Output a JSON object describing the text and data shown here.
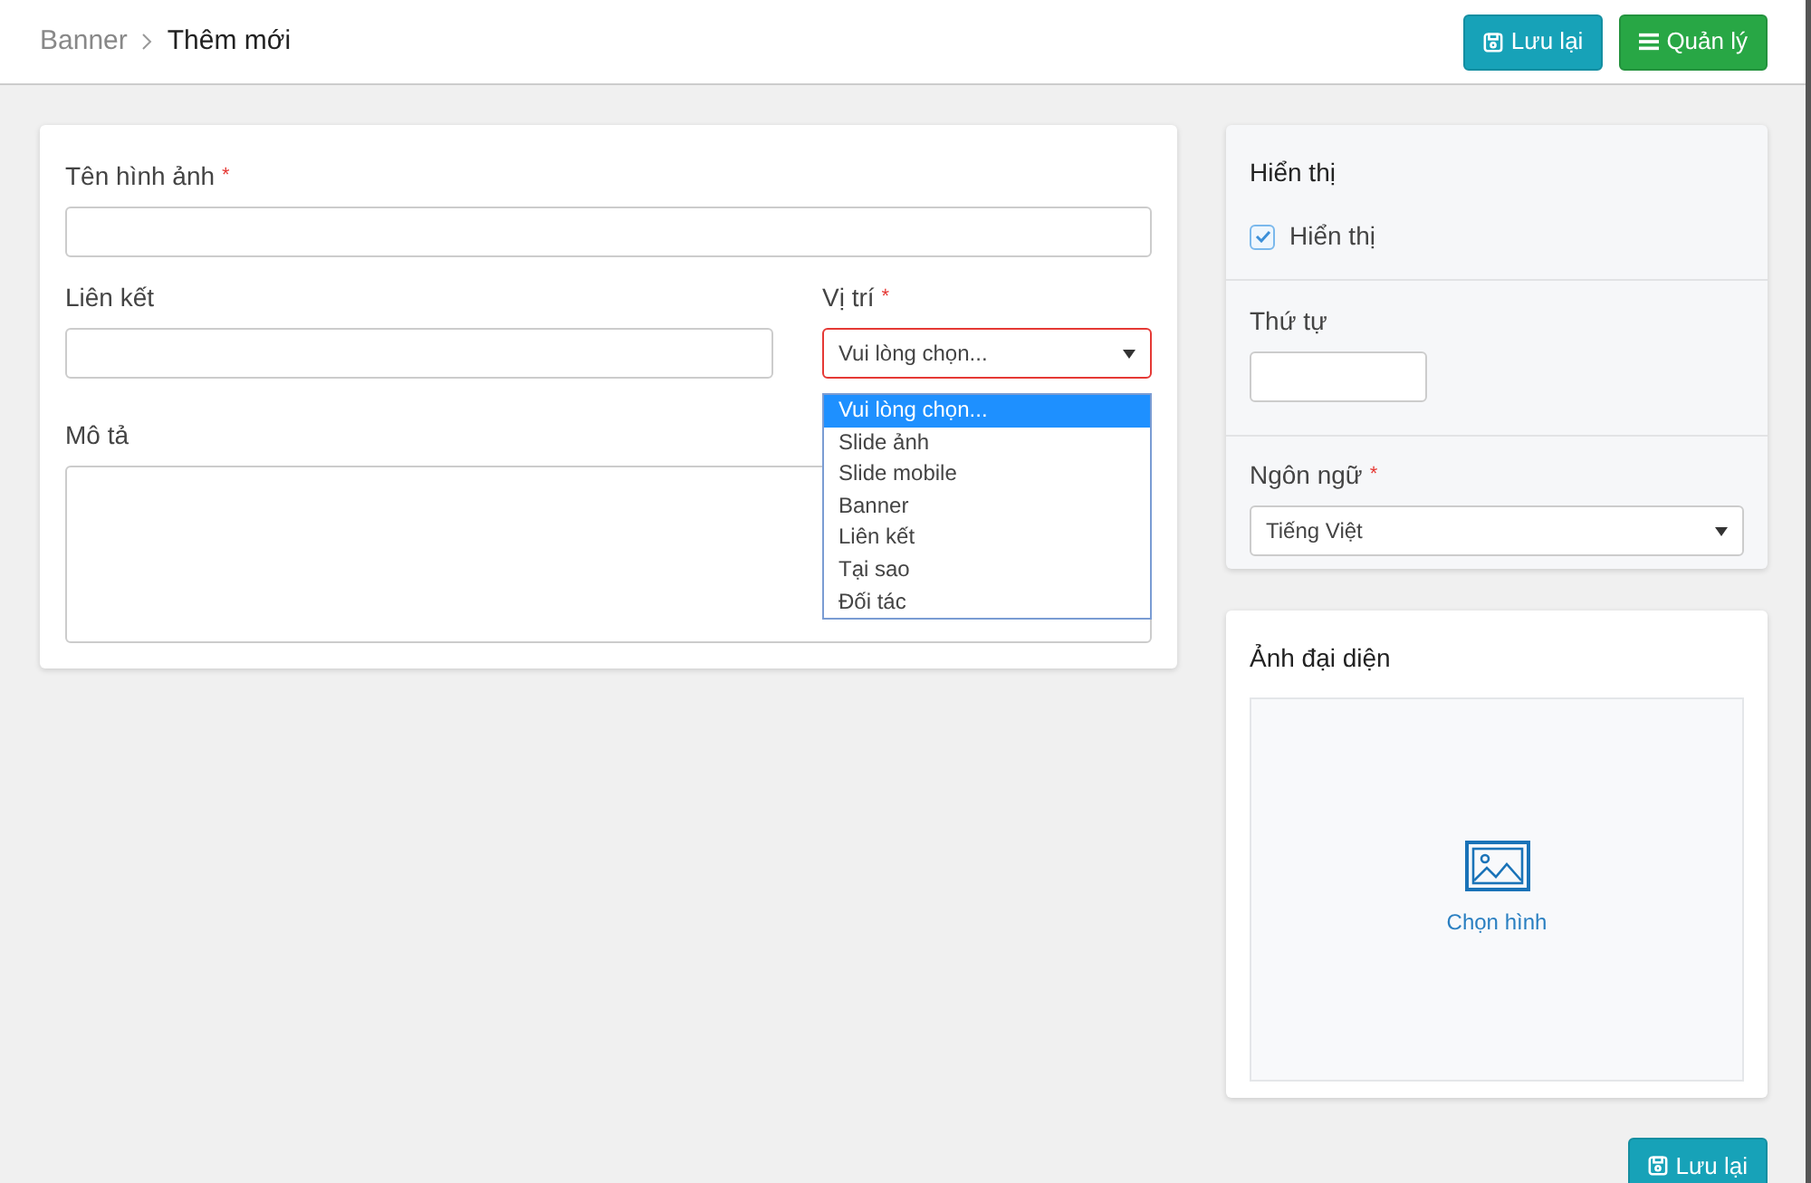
{
  "breadcrumb": [
    "Banner",
    "Thêm mới"
  ],
  "header_buttons": [
    {
      "kind": "save",
      "label": "Lưu lại"
    },
    {
      "kind": "list",
      "label": "Quản lý"
    }
  ],
  "form": {
    "name_field": {
      "label": "Tên hình ảnh",
      "required_mark": "*"
    },
    "link_field": {
      "label": "Liên kết"
    },
    "position_field": {
      "label": "Vị trí",
      "required_mark": "*",
      "value": "Vui lòng chọn...",
      "expanded": true,
      "invalid": true,
      "options": [
        {
          "label": "Vui lòng chọn...",
          "selected": true
        },
        {
          "label": "Slide ảnh",
          "selected": false
        },
        {
          "label": "Slide mobile",
          "selected": false
        },
        {
          "label": "Banner",
          "selected": false
        },
        {
          "label": "Liên kết",
          "selected": false
        },
        {
          "label": "Tại sao",
          "selected": false
        },
        {
          "label": "Đối tác",
          "selected": false
        }
      ]
    },
    "description_field": {
      "label": "Mô tả"
    }
  },
  "display_panel": {
    "title": "Hiển thị",
    "checkbox": {
      "label": "Hiển thị",
      "checked": true
    },
    "order_field": {
      "label": "Thứ tự"
    },
    "language_field": {
      "label": "Ngôn ngữ",
      "required_mark": "*",
      "value": "Tiếng Việt"
    }
  },
  "image_panel": {
    "title": "Ảnh đại diện",
    "picker_label": "Chọn hình"
  },
  "footer_button": {
    "kind": "save",
    "label": "Lưu lại"
  }
}
